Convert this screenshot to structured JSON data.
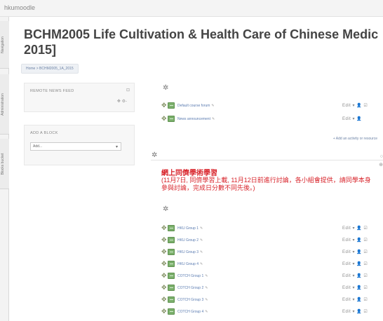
{
  "topbar": {
    "brand": "hkumoodle"
  },
  "sidetabs": [
    "Navigation",
    "Administration",
    "Blocks bucket"
  ],
  "course": {
    "title_line1": "BCHM2005 Life Cultivation & Health Care of Chinese Medic",
    "title_line2": "2015]"
  },
  "breadcrumb": "Home > BCHM2005_1A_2015",
  "blocks": {
    "news": {
      "title": "REMOTE NEWS FEED",
      "ctrl_top": "⊡",
      "ctrl_bottom": "✥ ⚙-"
    },
    "add_block": {
      "title": "ADD A BLOCK",
      "select_value": "Add...",
      "caret": "▾"
    }
  },
  "section0": {
    "activities": [
      {
        "name": "Default course forum",
        "edit": "✎",
        "controls": "Edit ▾  👤 ☑"
      },
      {
        "name": "News announcement",
        "edit": "✎",
        "controls": "Edit ▾  👤"
      }
    ],
    "add_link": "+ Add an activity or resource"
  },
  "section1": {
    "title": "網上同儕學術學習",
    "summary": "(11月7日, 同儕學習上載, 11月12日前進行討論，各小組會提供，請同學本身參與討論，完成日分數不同先後。)",
    "hint_top": "○",
    "hint_bottom": "⊕",
    "activities": [
      {
        "name": "HKU Group 1",
        "edit": "✎",
        "controls": "Edit ▾  👤 ☑"
      },
      {
        "name": "HKU Group 2",
        "edit": "✎",
        "controls": "Edit ▾  👤 ☑"
      },
      {
        "name": "HKU Group 3",
        "edit": "✎",
        "controls": "Edit ▾  👤 ☑"
      },
      {
        "name": "HKU Group 4",
        "edit": "✎",
        "controls": "Edit ▾  👤 ☑"
      },
      {
        "name": "COTCH Group 1",
        "edit": "✎",
        "controls": "Edit ▾  👤 ☑"
      },
      {
        "name": "COTCH Group 2",
        "edit": "✎",
        "controls": "Edit ▾  👤 ☑"
      },
      {
        "name": "COTCH Group 3",
        "edit": "✎",
        "controls": "Edit ▾  👤 ☑"
      },
      {
        "name": "COTCH Group 4",
        "edit": "✎",
        "controls": "Edit ▾  👤 ☑"
      }
    ]
  },
  "icons": {
    "move": "✥",
    "gear": "✲"
  }
}
